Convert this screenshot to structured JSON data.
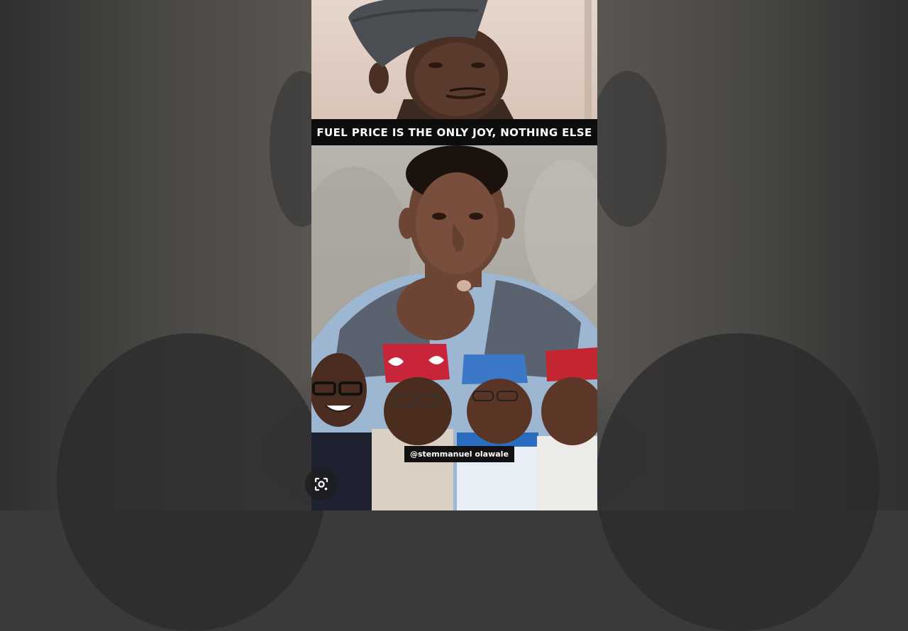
{
  "video": {
    "caption": "FUEL PRICE IS THE ONLY JOY, NOTHING ELSE",
    "watermark_handle": "@stemmanuel olawale"
  },
  "controls": {
    "lens_icon": "google-lens-icon"
  },
  "colors": {
    "caption_bg": "#0d0d0d",
    "caption_text": "#ffffff"
  }
}
